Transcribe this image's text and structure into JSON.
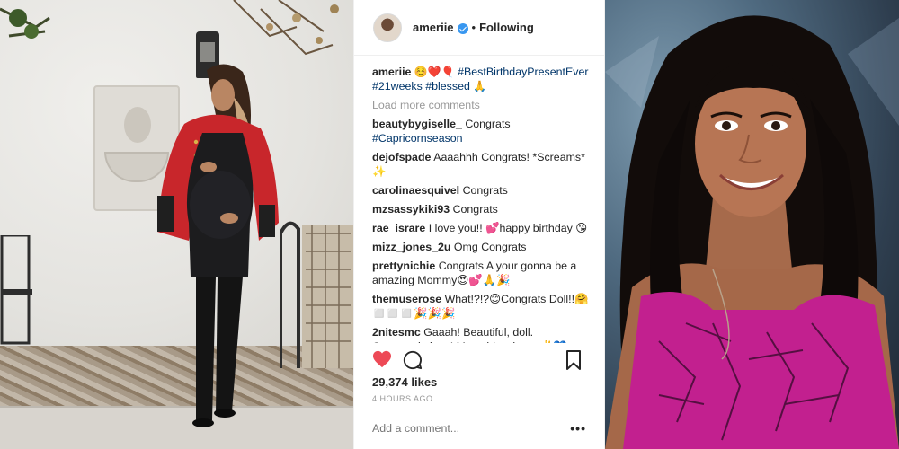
{
  "post": {
    "username": "ameriie",
    "follow_status": "Following",
    "separator": "•",
    "caption": {
      "username": "ameriie",
      "emoji": "☺️❤️🎈",
      "tags": [
        "#BestBirthdayPresentEver",
        "#21weeks",
        "#blessed"
      ],
      "tail_emoji": "🙏"
    },
    "load_more_label": "Load more comments",
    "comments": [
      {
        "user": "beautybygiselle_",
        "text": "Congrats",
        "tag": "#Capricornseason"
      },
      {
        "user": "dejofspade",
        "text": "Aaaahhh Congrats! *Screams* ✨"
      },
      {
        "user": "carolinaesquivel",
        "text": "Congrats"
      },
      {
        "user": "mzsassykiki93",
        "text": "Congrats"
      },
      {
        "user": "rae_israre",
        "text": "I love you!! 💕happy birthday 😘"
      },
      {
        "user": "mizz_jones_2u",
        "text": "Omg Congrats"
      },
      {
        "user": "prettynichie",
        "text": "Congrats A your gonna be a amazing Mommy😍💕🙏🎉"
      },
      {
        "user": "themuserose",
        "text": "What!?!?😊Congrats Doll!!🤗 ◻️◻️◻️🎉🎉🎉"
      },
      {
        "user": "2nitesmc",
        "text": "Gaaah! Beautiful, doll. Congratulations! Many blessings. ✌️💙"
      }
    ],
    "likes": "29,374 likes",
    "timestamp": "4 HOURS AGO",
    "add_comment_placeholder": "Add a comment...",
    "more_label": "•••"
  },
  "colors": {
    "like_red": "#ed4956",
    "hashtag_blue": "#003569",
    "verified_blue": "#3897f0",
    "jacket_red": "#c8262b",
    "top_magenta": "#c2208f"
  },
  "icons": [
    "verified-badge-icon",
    "heart-icon",
    "comment-icon",
    "bookmark-icon",
    "more-options-icon"
  ]
}
